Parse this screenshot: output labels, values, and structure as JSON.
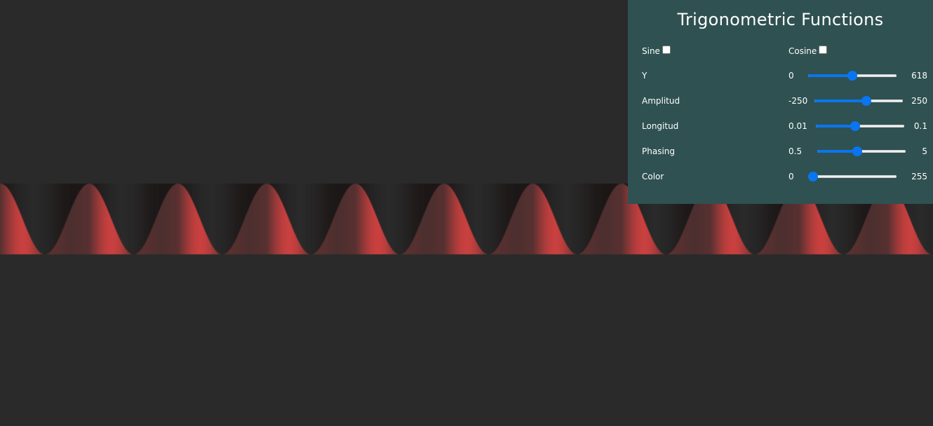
{
  "panel": {
    "title": "Trigonometric Functions",
    "toggles": [
      {
        "label": "Sine",
        "checked": false
      },
      {
        "label": "Cosine",
        "checked": false
      }
    ],
    "sliders": [
      {
        "label": "Y",
        "min": "0",
        "max": "618",
        "value_fraction": 0.5
      },
      {
        "label": "Amplitud",
        "min": "-250",
        "max": "250",
        "value_fraction": 0.6
      },
      {
        "label": "Longitud",
        "min": "0.01",
        "max": "0.1",
        "value_fraction": 0.44
      },
      {
        "label": "Phasing",
        "min": "0.5",
        "max": "5",
        "value_fraction": 0.45
      },
      {
        "label": "Color",
        "min": "0",
        "max": "255",
        "value_fraction": 0.0
      }
    ]
  },
  "colors": {
    "background": "#2a2a2a",
    "panel": "#2f5151",
    "slider_accent": "#0a75f0",
    "wave_red": "#c9403f"
  }
}
